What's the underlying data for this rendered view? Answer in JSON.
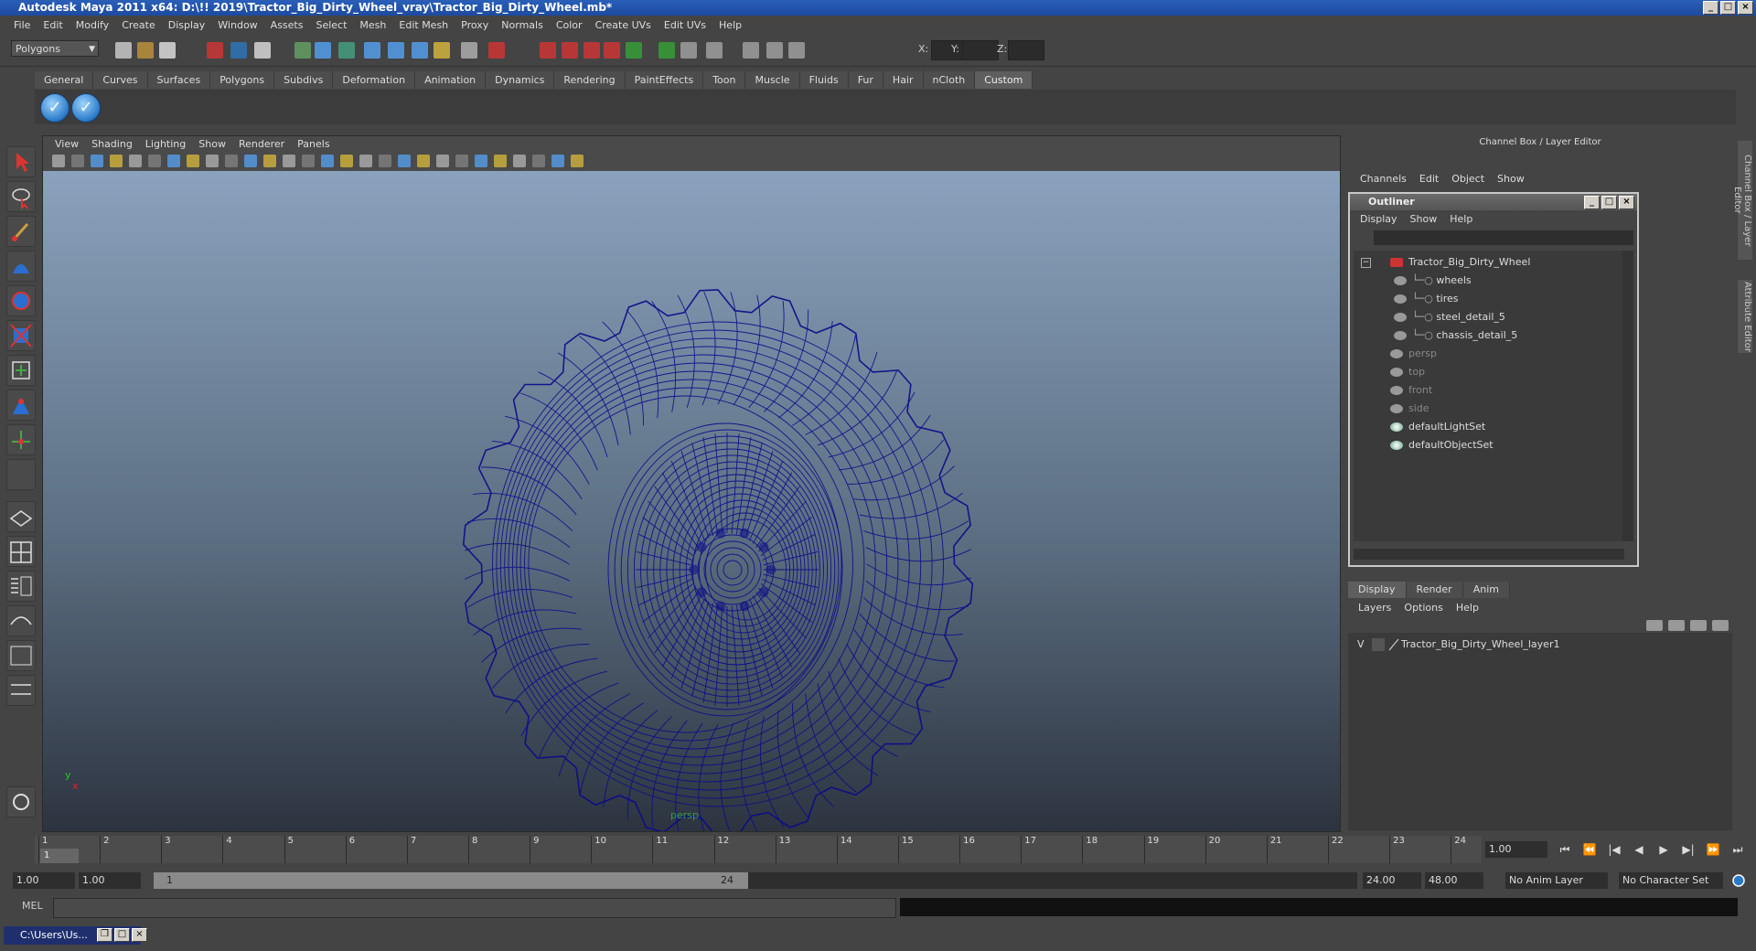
{
  "window": {
    "title": "Autodesk Maya 2011 x64: D:\\!! 2019\\Tractor_Big_Dirty_Wheel_vray\\Tractor_Big_Dirty_Wheel.mb*"
  },
  "menubar": [
    "File",
    "Edit",
    "Modify",
    "Create",
    "Display",
    "Window",
    "Assets",
    "Select",
    "Mesh",
    "Edit Mesh",
    "Proxy",
    "Normals",
    "Color",
    "Create UVs",
    "Edit UVs",
    "Help"
  ],
  "statusline": {
    "mode": "Polygons",
    "coord_labels": [
      "X:",
      "Y:",
      "Z:"
    ]
  },
  "shelf": {
    "tabs": [
      "General",
      "Curves",
      "Surfaces",
      "Polygons",
      "Subdivs",
      "Deformation",
      "Animation",
      "Dynamics",
      "Rendering",
      "PaintEffects",
      "Toon",
      "Muscle",
      "Fluids",
      "Fur",
      "Hair",
      "nCloth",
      "Custom"
    ],
    "active_tab": "Custom",
    "buttons": [
      "checkmark-icon",
      "checkmark-icon"
    ]
  },
  "viewport": {
    "menu": [
      "View",
      "Shading",
      "Lighting",
      "Show",
      "Renderer",
      "Panels"
    ],
    "camera": "persp",
    "axis_y": "y",
    "axis_x": "x",
    "wire_color": "#0a0a8a"
  },
  "channelbox": {
    "title": "Channel Box / Layer Editor",
    "menu": [
      "Channels",
      "Edit",
      "Object",
      "Show"
    ]
  },
  "outliner": {
    "title": "Outliner",
    "menu": [
      "Display",
      "Show",
      "Help"
    ],
    "items": [
      {
        "label": "Tractor_Big_Dirty_Wheel",
        "dim": false
      },
      {
        "label": "wheels",
        "dim": false
      },
      {
        "label": "tires",
        "dim": false
      },
      {
        "label": "steel_detail_5",
        "dim": false
      },
      {
        "label": "chassis_detail_5",
        "dim": false
      },
      {
        "label": "persp",
        "dim": true
      },
      {
        "label": "top",
        "dim": true
      },
      {
        "label": "front",
        "dim": true
      },
      {
        "label": "side",
        "dim": true
      },
      {
        "label": "defaultLightSet",
        "dim": false
      },
      {
        "label": "defaultObjectSet",
        "dim": false
      }
    ]
  },
  "layers": {
    "tabs": [
      "Display",
      "Render",
      "Anim"
    ],
    "active_tab": "Display",
    "menu": [
      "Layers",
      "Options",
      "Help"
    ],
    "row": {
      "visible": "V",
      "name": "Tractor_Big_Dirty_Wheel_layer1"
    }
  },
  "sidetabs": [
    "Channel Box / Layer Editor",
    "Attribute Editor"
  ],
  "timeline": {
    "ticks": [
      "1",
      "2",
      "3",
      "4",
      "5",
      "6",
      "7",
      "8",
      "9",
      "10",
      "11",
      "12",
      "13",
      "14",
      "15",
      "16",
      "17",
      "18",
      "19",
      "20",
      "21",
      "22",
      "23",
      "24"
    ],
    "current_frame": "1.00",
    "marker": "1"
  },
  "range": {
    "start": "1.00",
    "start2": "1.00",
    "slider_start": "1",
    "slider_end": "24",
    "end": "24.00",
    "end2": "48.00",
    "anim_layer": "No Anim Layer",
    "character_set": "No Character Set"
  },
  "cmdline": {
    "label": "MEL"
  },
  "taskbar": {
    "item": "C:\\Users\\Us..."
  }
}
